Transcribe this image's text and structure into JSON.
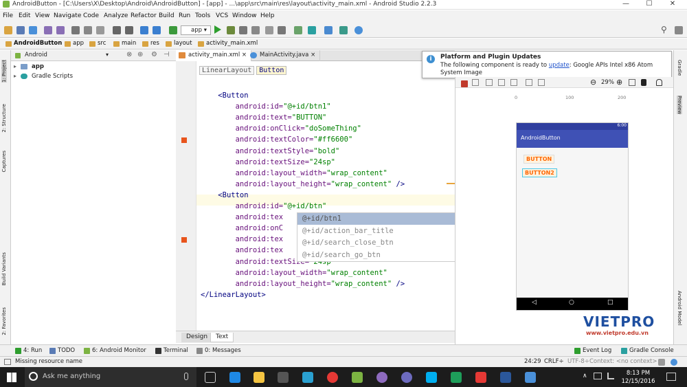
{
  "window": {
    "title": "AndroidButton - [C:\\Users\\X\\Desktop\\Android\\AndroidButton] - [app] - ...\\app\\src\\main\\res\\layout\\activity_main.xml - Android Studio 2.2.3",
    "min": "—",
    "max": "☐",
    "close": "✕"
  },
  "menu": [
    "File",
    "Edit",
    "View",
    "Navigate",
    "Code",
    "Analyze",
    "Refactor",
    "Build",
    "Run",
    "Tools",
    "VCS",
    "Window",
    "Help"
  ],
  "toolbar": {
    "module": "app",
    "search": "⚲"
  },
  "breadcrumb": [
    "AndroidButton",
    "app",
    "src",
    "main",
    "res",
    "layout",
    "activity_main.xml"
  ],
  "left_tabs": [
    "1: Project",
    "2: Structure",
    "Captures",
    "Build Variants",
    "2: Favorites"
  ],
  "project": {
    "view": "Android",
    "items": [
      "app",
      "Gradle Scripts"
    ]
  },
  "editor": {
    "tabs": [
      "activity_main.xml",
      "MainActivity.java"
    ],
    "crumbs": [
      "LinearLayout",
      "Button"
    ],
    "lines": [
      {
        "indent": "    ",
        "tag": "<Button"
      },
      {
        "indent": "        ",
        "attr": "android:id=",
        "val": "\"@+id/btn1\""
      },
      {
        "indent": "        ",
        "attr": "android:text=",
        "val": "\"BUTTON\""
      },
      {
        "indent": "        ",
        "attr": "android:onClick=",
        "val": "\"doSomeThing\""
      },
      {
        "indent": "        ",
        "attr": "android:textColor=",
        "val": "\"#ff6600\""
      },
      {
        "indent": "        ",
        "attr": "android:textStyle=",
        "val": "\"bold\""
      },
      {
        "indent": "        ",
        "attr": "android:textSize=",
        "val": "\"24sp\""
      },
      {
        "indent": "        ",
        "attr": "android:layout_width=",
        "val": "\"wrap_content\""
      },
      {
        "indent": "        ",
        "attr": "android:layout_height=",
        "val": "\"wrap_content\"",
        "end": " />"
      },
      {
        "indent": "    ",
        "tag": "<Button"
      },
      {
        "indent": "        ",
        "attr": "android:id=",
        "val": "\"@+id/btn\""
      },
      {
        "indent": "        ",
        "attr": "android:tex",
        "val": ""
      },
      {
        "indent": "        ",
        "attr": "android:onC",
        "val": ""
      },
      {
        "indent": "        ",
        "attr": "android:tex",
        "val": ""
      },
      {
        "indent": "        ",
        "attr": "android:tex",
        "val": ""
      },
      {
        "indent": "        ",
        "attr": "android:textSize=",
        "val": "\"24sp\""
      },
      {
        "indent": "        ",
        "attr": "android:layout_width=",
        "val": "\"wrap_content\""
      },
      {
        "indent": "        ",
        "attr": "android:layout_height=",
        "val": "\"wrap_content\"",
        "end": " />"
      },
      {
        "indent": "",
        "tag": "</LinearLayout>"
      }
    ],
    "autocomplete": [
      "@+id/btn1",
      "@+id/action_bar_title",
      "@+id/search_close_btn",
      "@+id/search_go_btn"
    ],
    "design_tabs": [
      "Design",
      "Text"
    ]
  },
  "notification": {
    "title": "Platform and Plugin Updates",
    "text": "The following component is ready to",
    "link": "update",
    "rest": ": Google APIs Intel x86 Atom System Image"
  },
  "preview": {
    "zoom": "29%",
    "ruler": [
      "0",
      "100",
      "200"
    ],
    "app_title": "AndroidButton",
    "time": "6:00",
    "buttons": [
      "BUTTON",
      "BUTTON2"
    ],
    "nav": [
      "◁",
      "○",
      "□"
    ]
  },
  "right_tabs": [
    "Gradle",
    "Preview",
    "Android Model"
  ],
  "watermark": {
    "brand": "VIETPRO",
    "url": "www.vietpro.edu.vn"
  },
  "bottom_tools": [
    "4: Run",
    "TODO",
    "6: Android Monitor",
    "Terminal",
    "0: Messages",
    "Event Log",
    "Gradle Console"
  ],
  "status": {
    "message": "Missing resource name",
    "position": "24:29",
    "crlf": "CRLF÷",
    "encoding": "UTF-8÷",
    "context": "Context: <no context>"
  },
  "taskbar": {
    "search": "Ask me anything",
    "time": "8:13 PM",
    "date": "12/15/2016"
  },
  "colors": {
    "accent": "#3f51b5",
    "text_color": "#ff6600",
    "selection": "#a9bbd6"
  }
}
